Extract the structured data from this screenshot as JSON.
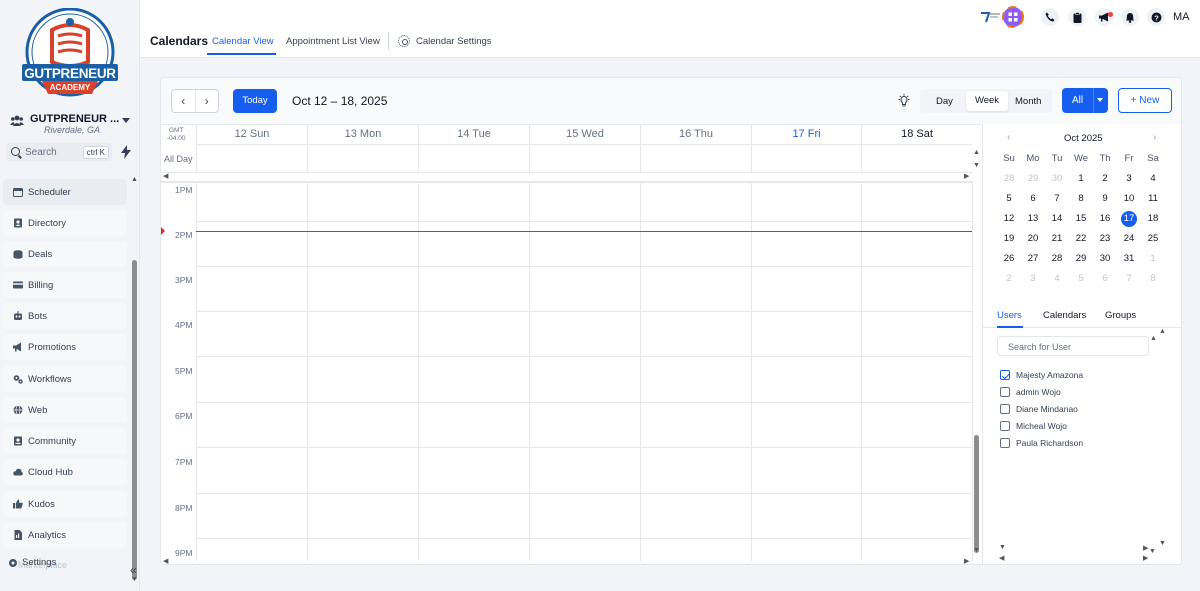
{
  "brand": {
    "logo_text_main": "GUTPRENEUR",
    "logo_text_sub": "ACADEMY",
    "colors": {
      "logo_blue": "#1a5ea6",
      "logo_red": "#d9412b",
      "accent": "#155eef"
    }
  },
  "account": {
    "name": "GUTPRENEUR ...",
    "location": "Riverdale, GA"
  },
  "search": {
    "placeholder": "Search",
    "shortcut": "ctrl K"
  },
  "sidebar": {
    "items": [
      {
        "label": "Scheduler",
        "icon": "calendar-icon"
      },
      {
        "label": "Directory",
        "icon": "contact-book-icon"
      },
      {
        "label": "Deals",
        "icon": "stack-icon"
      },
      {
        "label": "Billing",
        "icon": "credit-card-icon"
      },
      {
        "label": "Bots",
        "icon": "robot-icon"
      },
      {
        "label": "Promotions",
        "icon": "megaphone-icon"
      },
      {
        "label": "Workflows",
        "icon": "gears-icon"
      },
      {
        "label": "Web",
        "icon": "globe-icon"
      },
      {
        "label": "Community",
        "icon": "id-badge-icon"
      },
      {
        "label": "Cloud Hub",
        "icon": "cloud-icon"
      },
      {
        "label": "Kudos",
        "icon": "thumbs-up-icon"
      },
      {
        "label": "Analytics",
        "icon": "document-chart-icon"
      }
    ],
    "settings_label": "Settings",
    "ghost_label": "Marketplace"
  },
  "header": {
    "title": "Calendars",
    "tabs": [
      {
        "label": "Calendar View",
        "active": true
      },
      {
        "label": "Appointment List View",
        "active": false
      }
    ],
    "settings_link": "Calendar Settings",
    "user_initials": "MA"
  },
  "toolbar": {
    "today_label": "Today",
    "range": "Oct 12 – 18, 2025",
    "views": [
      "Day",
      "Week",
      "Month"
    ],
    "selected_view": "Week",
    "filter_label": "All",
    "new_label": "+ New"
  },
  "week": {
    "timezone_top": "GMT",
    "timezone_bottom": "-04:00",
    "all_day_label": "All Day",
    "days": [
      "12 Sun",
      "13 Mon",
      "14 Tue",
      "15 Wed",
      "16 Thu",
      "17 Fri",
      "18 Sat"
    ],
    "today_index": 5,
    "hours": [
      "1PM",
      "2PM",
      "3PM",
      "4PM",
      "5PM",
      "6PM",
      "7PM",
      "8PM",
      "9PM"
    ]
  },
  "mini_calendar": {
    "title": "Oct 2025",
    "weekdays": [
      "Su",
      "Mo",
      "Tu",
      "We",
      "Th",
      "Fr",
      "Sa"
    ],
    "weeks": [
      [
        "28",
        "29",
        "30",
        "1",
        "2",
        "3",
        "4"
      ],
      [
        "5",
        "6",
        "7",
        "8",
        "9",
        "10",
        "11"
      ],
      [
        "12",
        "13",
        "14",
        "15",
        "16",
        "17",
        "18"
      ],
      [
        "19",
        "20",
        "21",
        "22",
        "23",
        "24",
        "25"
      ],
      [
        "26",
        "27",
        "28",
        "29",
        "30",
        "31",
        "1"
      ],
      [
        "2",
        "3",
        "4",
        "5",
        "6",
        "7",
        "8"
      ]
    ],
    "selected": "17"
  },
  "side_tabs": [
    "Users",
    "Calendars",
    "Groups"
  ],
  "user_search_placeholder": "Search for User",
  "users": [
    {
      "name": "Majesty Amazona",
      "checked": true
    },
    {
      "name": "admin Wojo",
      "checked": false
    },
    {
      "name": "Diane Mindanao",
      "checked": false
    },
    {
      "name": "Micheal Wojo",
      "checked": false
    },
    {
      "name": "Paula Richardson",
      "checked": false
    }
  ]
}
